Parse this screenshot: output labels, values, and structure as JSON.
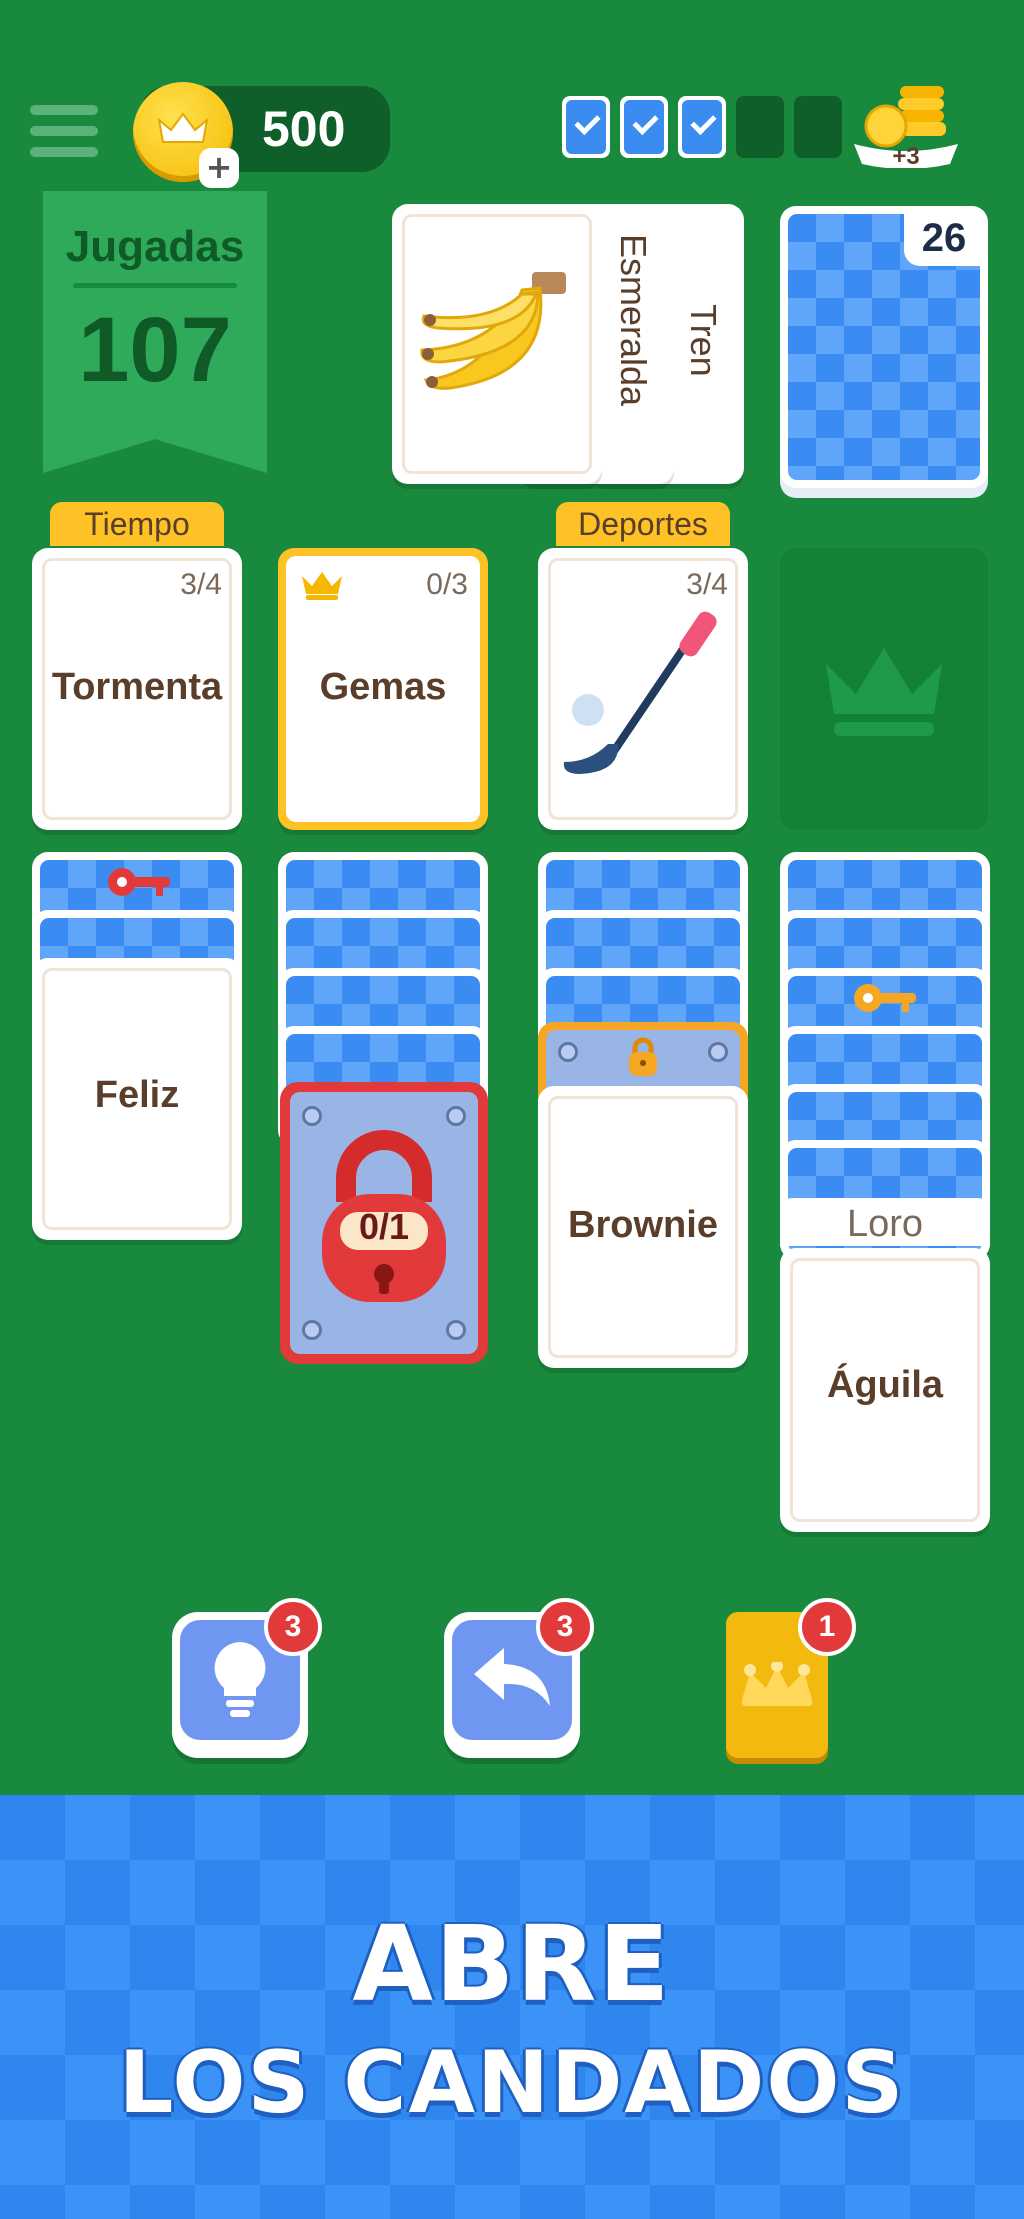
{
  "header": {
    "coins": "500",
    "coin_plus": "+",
    "streak": [
      true,
      true,
      true,
      false,
      false
    ],
    "reward_label": "+3"
  },
  "score": {
    "title": "Jugadas",
    "value": "107"
  },
  "waste": {
    "cards": [
      "Esmeralda",
      "Tren"
    ],
    "top_card_image": "banana"
  },
  "stock": {
    "count": "26"
  },
  "foundations": [
    {
      "tag": "Tiempo",
      "name": "Tormenta",
      "progress": "3/4"
    },
    {
      "name": "Gemas",
      "progress": "0/3",
      "crown": true
    },
    {
      "tag": "Deportes",
      "progress": "3/4",
      "image": "golf-club"
    },
    {
      "empty": true,
      "icon": "crown-icon"
    }
  ],
  "tableau": {
    "col1_card": "Feliz",
    "col2_lock": "0/1",
    "col3_card": "Brownie",
    "col4_tab": "Loro",
    "col4_card": "Águila"
  },
  "powerups": {
    "hint_count": "3",
    "undo_count": "3",
    "joker_count": "1"
  },
  "banner": {
    "line1": "ABRE",
    "line2": "LOS CANDADOS"
  },
  "colors": {
    "felt": "#19893d",
    "card_back": "#3b8cf2",
    "accent_gold": "#ffc226",
    "lock_red": "#e23a3a"
  }
}
